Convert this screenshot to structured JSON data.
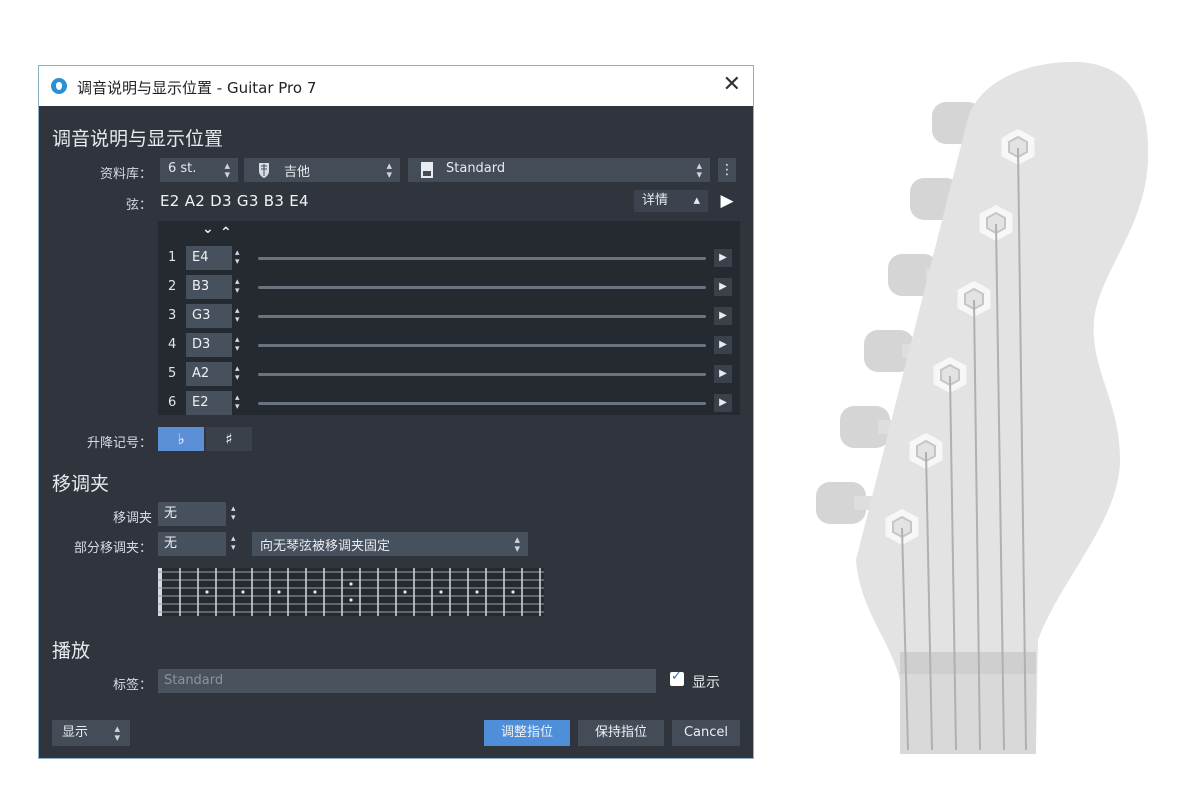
{
  "window": {
    "title": "调音说明与显示位置 - Guitar Pro 7",
    "close_glyph": "✕"
  },
  "tuning_section": {
    "title": "调音说明与显示位置",
    "library_label": "资料库：",
    "string_count": "6 st.",
    "instrument": "吉他",
    "preset": "Standard",
    "more_glyph": "⋮",
    "strings_label": "弦：",
    "strings_value": "E2 A2 D3 G3 B3 E4",
    "details_label": "详情",
    "details_arrow": "▴",
    "play_glyph": "▶"
  },
  "tuning_rows": [
    {
      "num": "1",
      "note": "E4"
    },
    {
      "num": "2",
      "note": "B3"
    },
    {
      "num": "3",
      "note": "G3"
    },
    {
      "num": "4",
      "note": "D3"
    },
    {
      "num": "5",
      "note": "A2"
    },
    {
      "num": "6",
      "note": "E2"
    }
  ],
  "row_play_glyph": "▶",
  "spin_up": "▴",
  "spin_down": "▾",
  "chevron_down": "⌄",
  "chevron_up": "⌃",
  "accidentals": {
    "label": "升降记号：",
    "flat": "♭",
    "sharp": "♯"
  },
  "capo_section": {
    "title": "移调夹",
    "capo_label": "移调夹",
    "capo_value": "无",
    "partial_label": "部分移调夹：",
    "partial_value": "无",
    "partial_mode": "向无琴弦被移调夹固定"
  },
  "playback_section": {
    "title": "播放",
    "tag_label": "标签：",
    "tag_placeholder": "Standard",
    "show_label": "显示"
  },
  "footer": {
    "display_select": "显示",
    "adjust_button": "调整指位",
    "keep_button": "保持指位",
    "cancel_button": "Cancel"
  },
  "colors": {
    "dialog_bg": "#2f343d",
    "accent": "#4f8fda",
    "headstock": "#e3e3e3"
  }
}
